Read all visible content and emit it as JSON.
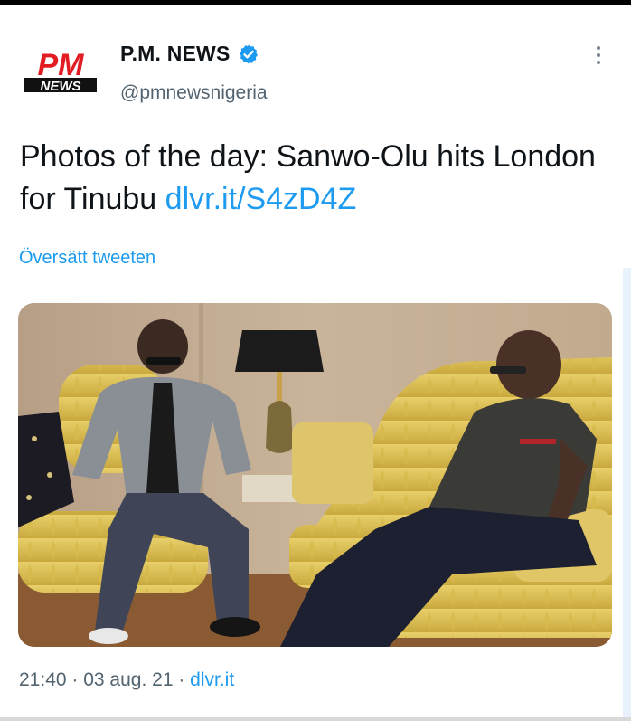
{
  "account": {
    "display_name": "P.M. NEWS",
    "handle": "@pmnewsnigeria",
    "verified": true,
    "avatar": {
      "logo_text_top": "PM",
      "logo_text_bottom": "NEWS",
      "color": "#e31b23"
    }
  },
  "tweet": {
    "text": "Photos of the day: Sanwo-Olu hits London for Tinubu ",
    "link": "dlvr.it/S4zD4Z",
    "translate_label": "Översätt tweeten"
  },
  "footer": {
    "time": "21:40",
    "separator": " · ",
    "date": "03 aug. 21",
    "source": "dlvr.it"
  },
  "icons": {
    "verified": "verified-badge-icon",
    "more": "more-options-icon"
  },
  "colors": {
    "accent": "#1d9bf0",
    "text_primary": "#0f1419",
    "text_secondary": "#536471"
  }
}
